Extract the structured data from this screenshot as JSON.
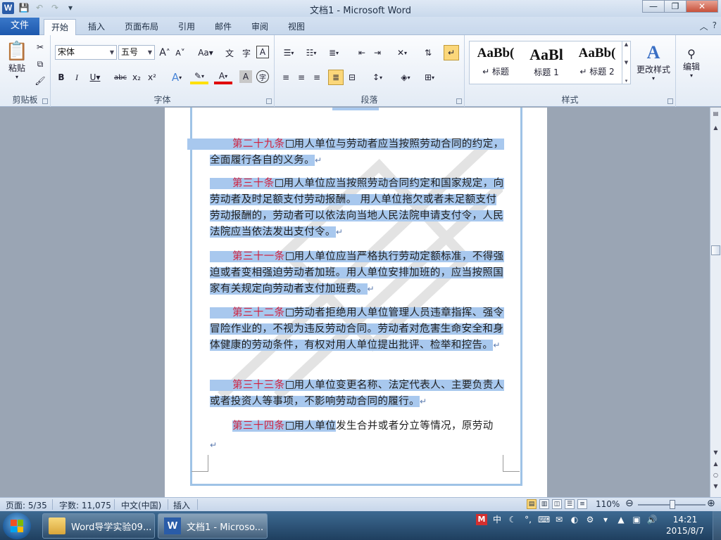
{
  "window": {
    "title": "文档1 - Microsoft Word"
  },
  "tabs": {
    "file": "文件",
    "items": [
      "开始",
      "插入",
      "页面布局",
      "引用",
      "邮件",
      "审阅",
      "视图"
    ],
    "active": 0
  },
  "ribbon": {
    "clipboard": {
      "label": "剪贴板",
      "paste": "粘贴"
    },
    "font": {
      "label": "字体",
      "font_name": "宋体",
      "font_size": "五号",
      "grow": "A",
      "shrink": "A",
      "case": "Aa",
      "bold": "B",
      "italic": "I",
      "underline": "U",
      "strike": "abc",
      "sub": "x₂",
      "sup": "x²",
      "effects": "A",
      "color": "A",
      "shade": "A",
      "enclose": "字"
    },
    "paragraph": {
      "label": "段落"
    },
    "styles": {
      "label": "样式",
      "items": [
        {
          "sample": "AaBb(",
          "name": "↵ 标题"
        },
        {
          "sample": "AaBl",
          "name": "标题 1"
        },
        {
          "sample": "AaBb(",
          "name": "↵ 标题 2"
        }
      ],
      "change": "更改样式"
    },
    "editing": {
      "label": "编辑"
    }
  },
  "document": {
    "paragraphs": [
      {
        "num": "第二十九条",
        "body": "用人单位与劳动者应当按照劳动合同的约定，全面履行各自的义务。"
      },
      {
        "num": "第三十条",
        "body": "用人单位应当按照劳动合同约定和国家规定，向劳动者及时足额支付劳动报酬。 用人单位拖欠或者未足额支付劳动报酬的，劳动者可以依法向当地人民法院申请支付令，人民法院应当依法发出支付令。"
      },
      {
        "num": "第三十一条",
        "body": "用人单位应当严格执行劳动定额标准，不得强迫或者变相强迫劳动者加班。用人单位安排加班的，应当按照国家有关规定向劳动者支付加班费。"
      },
      {
        "num": "第三十二条",
        "body": "劳动者拒绝用人单位管理人员违章指挥、强令冒险作业的，不视为违反劳动合同。劳动者对危害生命安全和身体健康的劳动条件，有权对用人单位提出批评、检举和控告。"
      },
      {
        "num": "第三十三条",
        "body": "用人单位变更名称、法定代表人、主要负责人或者投资人等事项，不影响劳动合同的履行。"
      },
      {
        "num": "第三十四条",
        "body_selected": "用人单位",
        "body_rest": "发生合并或者分立等情况，原劳动"
      }
    ],
    "para_mark": "↵"
  },
  "statusbar": {
    "page": "页面: 5/35",
    "words": "字数: 11,075",
    "lang": "中文(中国)",
    "mode": "插入",
    "zoom": "110%",
    "zoom_level": 1.1
  },
  "taskbar": {
    "items": [
      {
        "label": "Word导学实验09..."
      },
      {
        "label": "文档1 - Microso..."
      }
    ],
    "ime": "中",
    "time": "14:21",
    "date": "2015/8/7"
  },
  "colors": {
    "selection": "#a8c8ee",
    "article_num": "#d0213e",
    "file_tab": "#1d58ad"
  }
}
